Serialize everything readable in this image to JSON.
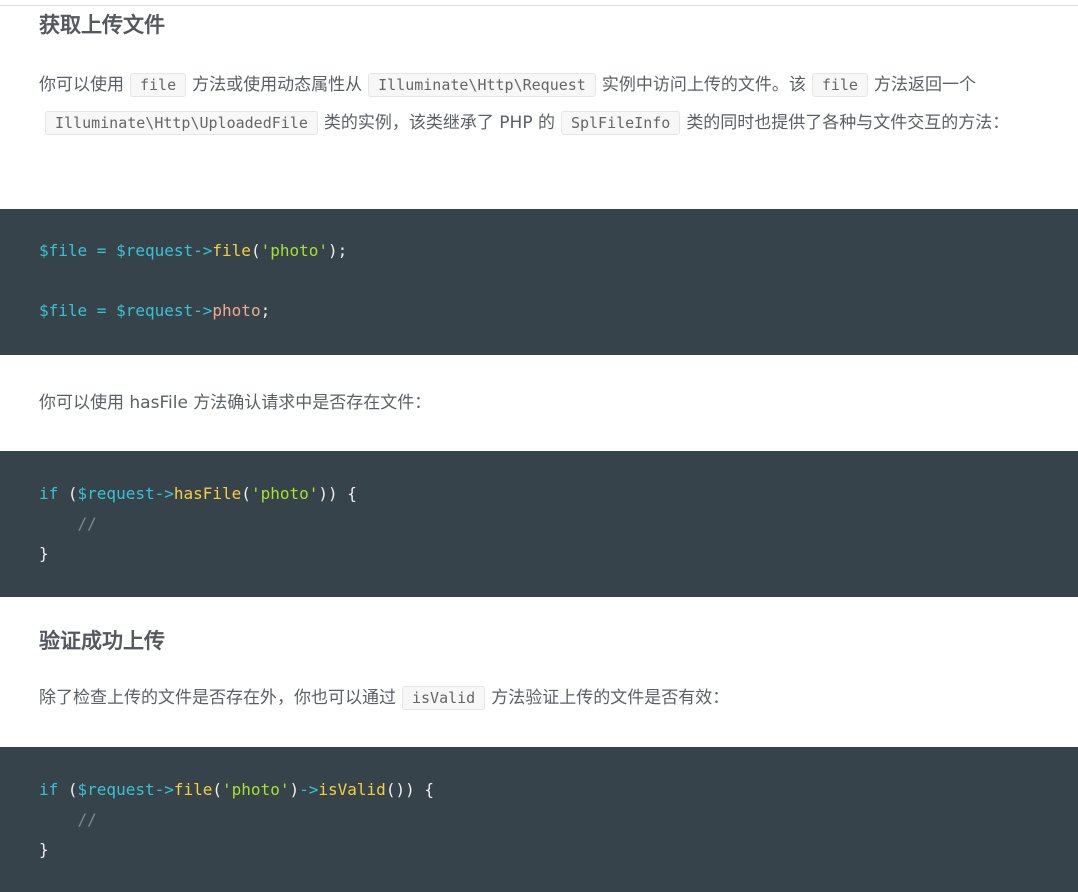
{
  "section1": {
    "heading": "获取上传文件",
    "para": {
      "t1": "你可以使用",
      "c1": "file",
      "t2": "方法或使用动态属性从",
      "c2": "Illuminate\\Http\\Request",
      "t3": "实例中访问上传的文件。该",
      "c3": "file",
      "t4": "方法返回一个",
      "c4": "Illuminate\\Http\\UploadedFile",
      "t5": "类的实例，该类继承了 PHP 的",
      "c5": "SplFileInfo",
      "t6": "类的同时也提供了各种与文件交互的方法："
    },
    "code": {
      "l1": {
        "var": "$file",
        "eq": " = ",
        "req": "$request",
        "arrow": "->",
        "fn": "file",
        "open": "(",
        "str": "'photo'",
        "close": ");"
      },
      "l2": {
        "var": "$file",
        "eq": " = ",
        "req": "$request",
        "arrow": "->",
        "prop": "photo",
        "end": ";"
      }
    }
  },
  "section2": {
    "para": "你可以使用 hasFile 方法确认请求中是否存在文件：",
    "code": {
      "l1": {
        "kw": "if",
        "open": " (",
        "req": "$request",
        "arrow": "->",
        "fn": "hasFile",
        "p1": "(",
        "str": "'photo'",
        "close": ")) {"
      },
      "l2": "//",
      "l3": "}"
    }
  },
  "section3": {
    "heading": "验证成功上传",
    "para": {
      "t1": "除了检查上传的文件是否存在外，你也可以通过",
      "c1": "isValid",
      "t2": "方法验证上传的文件是否有效："
    },
    "code": {
      "l1": {
        "kw": "if",
        "open": " (",
        "req": "$request",
        "arrow": "->",
        "fn": "file",
        "p1": "(",
        "str": "'photo'",
        "p2": ")",
        "arrow2": "->",
        "fn2": "isValid",
        "close": "()) {"
      },
      "l2": "//",
      "l3": "}"
    }
  }
}
